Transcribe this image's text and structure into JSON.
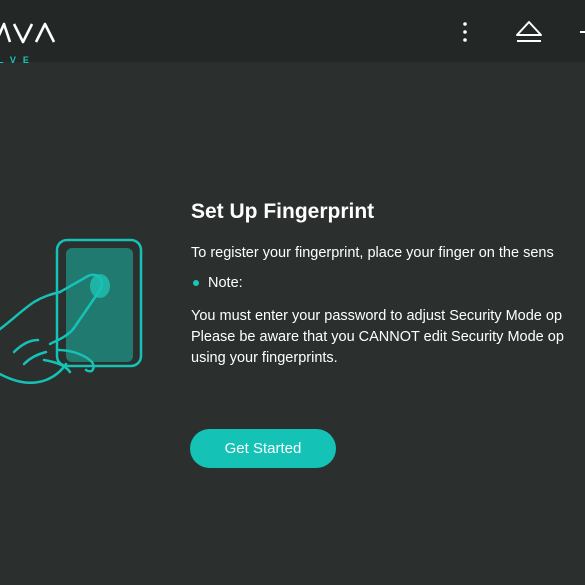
{
  "header": {
    "logo_text": "AVA",
    "logo_subtext": "LVE",
    "icons": [
      "more-vertical-icon",
      "eject-icon",
      "minimize-icon"
    ]
  },
  "main": {
    "title": "Set Up Fingerprint",
    "description": "To register your fingerprint, place your finger on the sens",
    "note_label": "Note:",
    "note_lines": [
      "You must enter your password to adjust Security Mode op",
      "Please be aware that you CANNOT edit Security Mode op",
      "using your fingerprints."
    ],
    "cta_label": "Get Started"
  },
  "colors": {
    "background": "#2b2f2e",
    "topbar": "#232827",
    "accent": "#15c3b6",
    "text": "#ffffff"
  }
}
